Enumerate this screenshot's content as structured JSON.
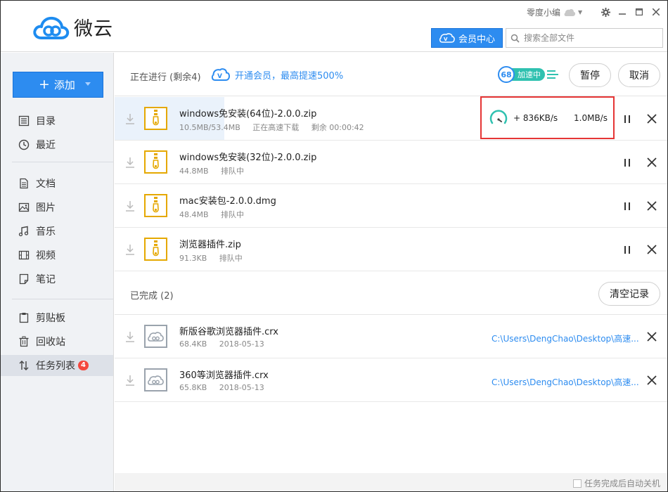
{
  "app": {
    "name": "微云"
  },
  "header": {
    "user_name": "零度小编",
    "vip_center_label": "会员中心",
    "search_placeholder": "搜索全部文件"
  },
  "sidebar": {
    "add_label": "添加",
    "groups": [
      [
        {
          "label": "目录",
          "icon": "list-icon"
        },
        {
          "label": "最近",
          "icon": "clock-icon"
        }
      ],
      [
        {
          "label": "文档",
          "icon": "document-icon"
        },
        {
          "label": "图片",
          "icon": "image-icon"
        },
        {
          "label": "音乐",
          "icon": "music-icon"
        },
        {
          "label": "视频",
          "icon": "video-icon"
        },
        {
          "label": "笔记",
          "icon": "note-icon"
        }
      ],
      [
        {
          "label": "剪贴板",
          "icon": "clipboard-icon"
        },
        {
          "label": "回收站",
          "icon": "trash-icon"
        },
        {
          "label": "任务列表",
          "icon": "transfer-icon",
          "badge": "4",
          "active": true
        }
      ]
    ]
  },
  "in_progress": {
    "title": "正在进行 (剩余4)",
    "promo_text": "开通会员，最高提速500%",
    "speed_level": "68",
    "speed_badge_label": "加速中",
    "pause_all_label": "暂停",
    "cancel_all_label": "取消",
    "items": [
      {
        "name": "windows免安装(64位)-2.0.0.zip",
        "size": "10.5MB/53.4MB",
        "status": "正在高速下载",
        "remaining": "剩余 00:00:42",
        "progress": 0.197,
        "speed_up": "+ 836KB/s",
        "speed_down": "1.0MB/s"
      },
      {
        "name": "windows免安装(32位)-2.0.0.zip",
        "size": "44.8MB",
        "status": "排队中"
      },
      {
        "name": "mac安装包-2.0.0.dmg",
        "size": "48.4MB",
        "status": "排队中"
      },
      {
        "name": "浏览器插件.zip",
        "size": "91.3KB",
        "status": "排队中"
      }
    ]
  },
  "completed": {
    "title": "已完成 (2)",
    "clear_label": "清空记录",
    "items": [
      {
        "name": "新版谷歌浏览器插件.crx",
        "size": "68.4KB",
        "date": "2018-05-13",
        "path": "C:\\Users\\DengChao\\Desktop\\高速..."
      },
      {
        "name": "360等浏览器插件.crx",
        "size": "65.8KB",
        "date": "2018-05-13",
        "path": "C:\\Users\\DengChao\\Desktop\\高速..."
      }
    ]
  },
  "footer": {
    "auto_shutdown_label": "任务完成后自动关机"
  },
  "colors": {
    "accent": "#2d8cf0",
    "highlight_border": "#e53535",
    "zip_icon": "#e5a800",
    "speed_pill": "#2fc1b0"
  }
}
